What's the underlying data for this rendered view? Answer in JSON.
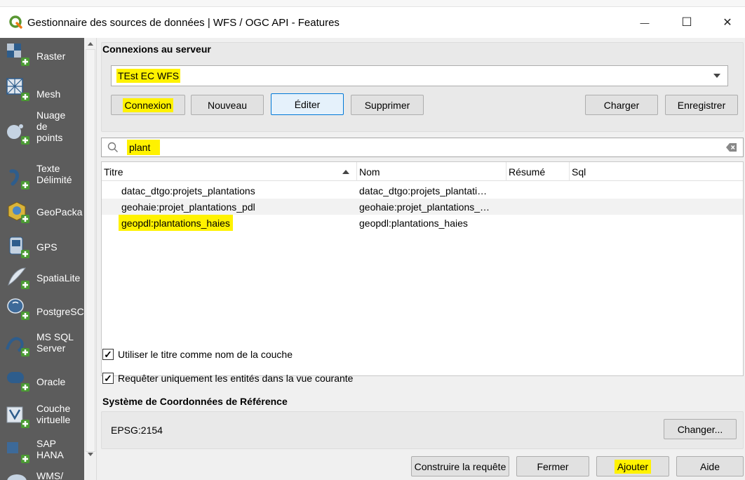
{
  "window": {
    "title": "Gestionnaire des sources de données | WFS / OGC API - Features",
    "minimize": "—",
    "maximize": "☐",
    "close": "✕"
  },
  "sidebar": {
    "items": [
      {
        "label": "Raster",
        "icon": "raster-icon"
      },
      {
        "label": "Mesh",
        "icon": "mesh-icon"
      },
      {
        "label": "Nuage\nde\npoints",
        "icon": "point-cloud-icon"
      },
      {
        "label": "Texte\nDélimité",
        "icon": "delimited-text-icon"
      },
      {
        "label": "GeoPacka",
        "icon": "geopackage-icon"
      },
      {
        "label": "GPS",
        "icon": "gps-icon"
      },
      {
        "label": "SpatiaLite",
        "icon": "spatialite-icon"
      },
      {
        "label": "PostgreSC",
        "icon": "postgresql-icon"
      },
      {
        "label": "MS SQL\nServer",
        "icon": "mssql-icon"
      },
      {
        "label": "Oracle",
        "icon": "oracle-icon"
      },
      {
        "label": "Couche\nvirtuelle",
        "icon": "virtual-layer-icon"
      },
      {
        "label": "SAP\nHANA",
        "icon": "sap-hana-icon"
      },
      {
        "label": "WMS/",
        "icon": "wms-icon"
      }
    ]
  },
  "connections": {
    "section_title": "Connexions au serveur",
    "selected": "TEst EC WFS",
    "buttons": {
      "connect": "Connexion",
      "new": "Nouveau",
      "edit": "Éditer",
      "delete": "Supprimer",
      "load": "Charger",
      "save": "Enregistrer"
    }
  },
  "search": {
    "value": "plant",
    "clear_icon": "clear-icon"
  },
  "table": {
    "columns": [
      "Titre",
      "Nom",
      "Résumé",
      "Sql"
    ],
    "rows": [
      {
        "titre": "datac_dtgo:projets_plantations",
        "nom": "datac_dtgo:projets_plantati…",
        "resume": "",
        "sql": ""
      },
      {
        "titre": "geohaie:projet_plantations_pdl",
        "nom": "geohaie:projet_plantations_…",
        "resume": "",
        "sql": ""
      },
      {
        "titre": "geopdl:plantations_haies",
        "nom": "geopdl:plantations_haies",
        "resume": "",
        "sql": ""
      }
    ]
  },
  "options": {
    "use_title": {
      "label": "Utiliser le titre comme nom de la couche",
      "checked": true
    },
    "current_view": {
      "label": "Requêter uniquement les entités dans la vue courante",
      "checked": true
    }
  },
  "crs": {
    "section_title": "Système de Coordonnées de Référence",
    "value": "EPSG:2154",
    "change_button": "Changer..."
  },
  "footer": {
    "build_query": "Construire la requête",
    "close": "Fermer",
    "add": "Ajouter",
    "help": "Aide"
  },
  "colors": {
    "highlight": "#fff200",
    "sidebar_bg": "#5c5c5c",
    "focus_border": "#0078d7"
  }
}
